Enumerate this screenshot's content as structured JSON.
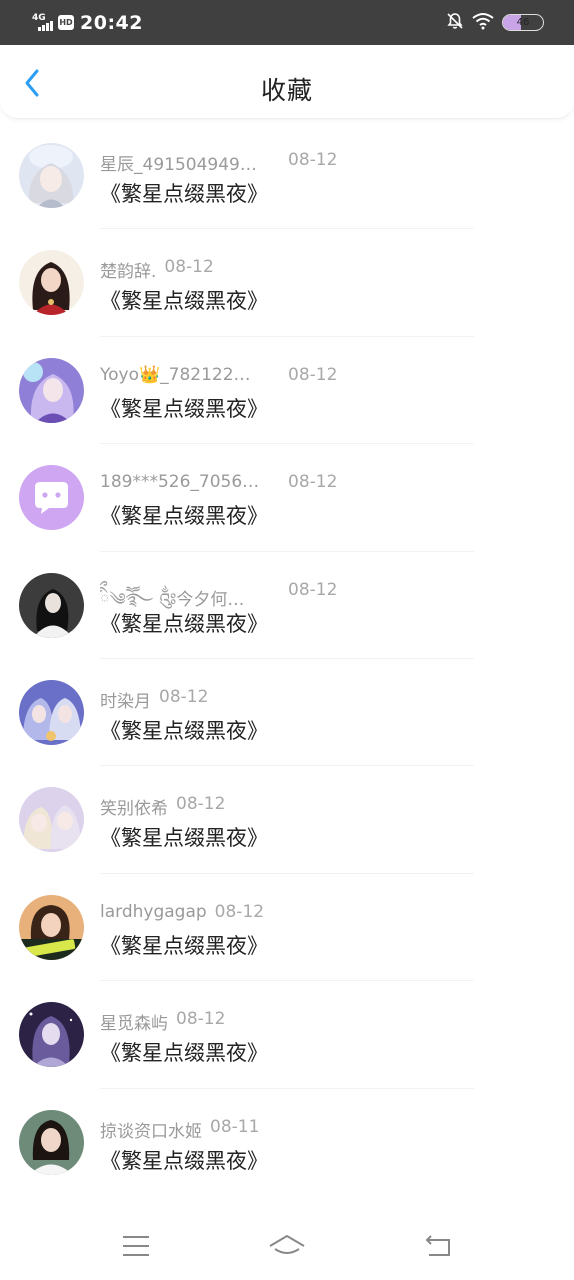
{
  "status_bar": {
    "network": "4G",
    "hd": "HD",
    "time": "20:42",
    "battery": "46",
    "battery_level": 0.46
  },
  "header": {
    "title": "收藏"
  },
  "items": [
    {
      "name": "星辰_491504949…",
      "date": "08-12",
      "title": "《繁星点缀黑夜》",
      "avatar": "anime-girl-white-hair"
    },
    {
      "name": "楚韵辞.",
      "date": "08-12",
      "title": "《繁星点缀黑夜》",
      "avatar": "girl-red-dress"
    },
    {
      "name": "Yoyo👑_782122…",
      "date": "08-12",
      "title": "《繁星点缀黑夜》",
      "avatar": "anime-girl-purple"
    },
    {
      "name": "189***526_7056…",
      "date": "08-12",
      "title": "《繁星点缀黑夜》",
      "avatar": "default-chat-avatar"
    },
    {
      "name": "ིྀ༄ཽ࿐ ༂今夕何…",
      "date": "08-12",
      "title": "《繁星点缀黑夜》",
      "avatar": "girl-dark-hair"
    },
    {
      "name": "时染月",
      "date": "08-12",
      "title": "《繁星点缀黑夜》",
      "avatar": "anime-couple"
    },
    {
      "name": "笑别依希",
      "date": "08-12",
      "title": "《繁星点缀黑夜》",
      "avatar": "anime-girls-pastel"
    },
    {
      "name": "lardhygagap",
      "date": "08-12",
      "title": "《繁星点缀黑夜》",
      "avatar": "game-girl"
    },
    {
      "name": "星觅森屿",
      "date": "08-12",
      "title": "《繁星点缀黑夜》",
      "avatar": "girl-starry"
    },
    {
      "name": "掠谈资口水姬",
      "date": "08-11",
      "title": "《繁星点缀黑夜》",
      "avatar": "girl-photo"
    }
  ],
  "icons": {
    "back": "chevron-left-icon",
    "menu": "menu-icon",
    "home": "home-icon",
    "back_nav": "back-arrow-icon"
  },
  "colors": {
    "accent": "#2a9df4",
    "status_bar": "#404040",
    "meta_text": "#9a9a9a",
    "title_text": "#222222"
  }
}
